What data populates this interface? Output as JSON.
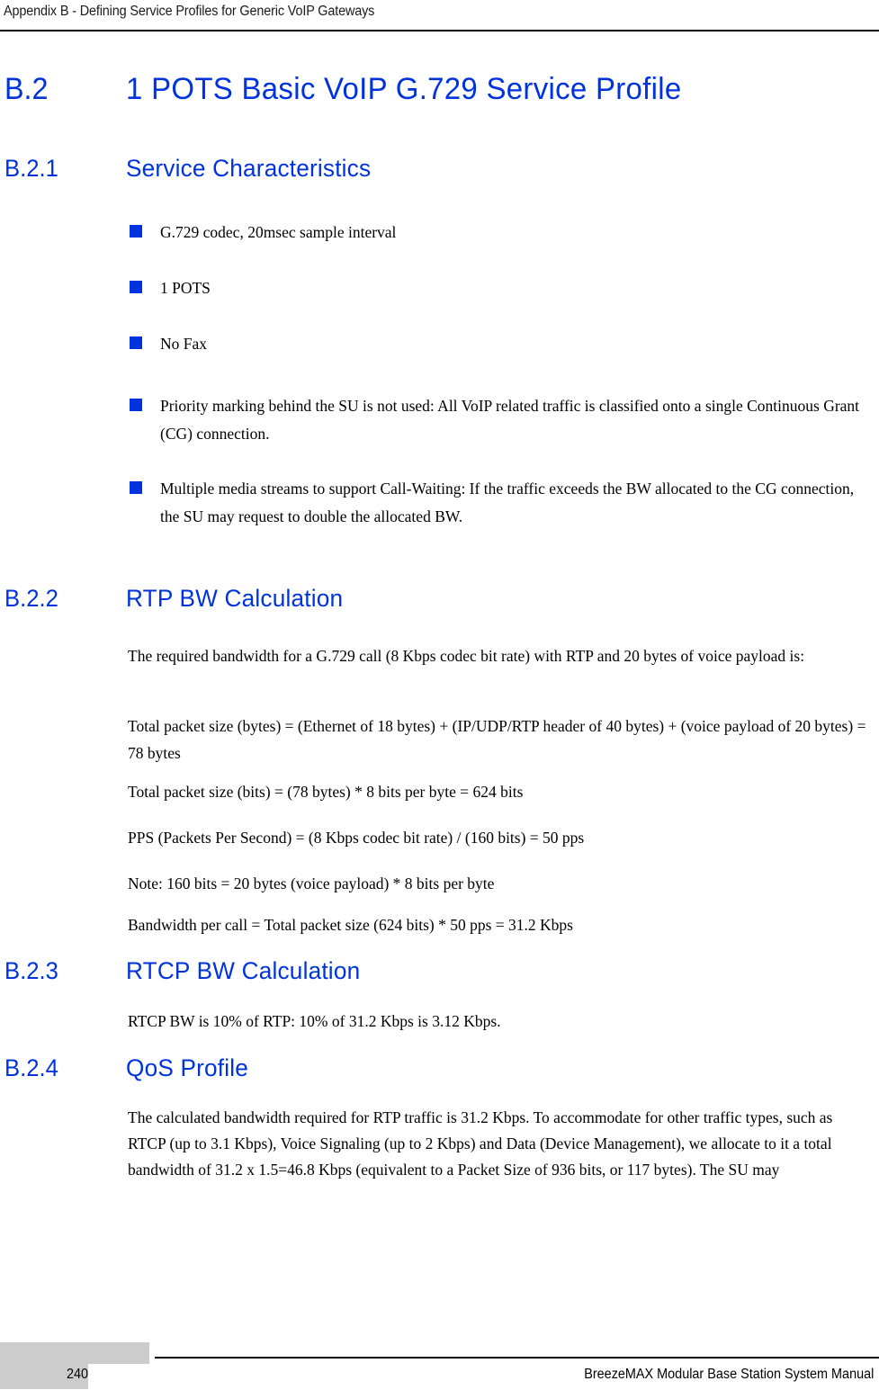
{
  "header": {
    "running_head": "Appendix B - Defining Service Profiles for Generic VoIP Gateways"
  },
  "colors": {
    "heading_blue": "#0033dd",
    "bullet_blue": "#0033dd",
    "footer_gray": "#cccccc",
    "body_black": "#000000"
  },
  "title": {
    "number": "B.2",
    "text": "1 POTS Basic VoIP G.729 Service Profile"
  },
  "sections": [
    {
      "number": "B.2.1",
      "title": "Service Characteristics",
      "bullets": [
        "G.729 codec, 20msec sample interval",
        "1 POTS",
        "No Fax",
        "Priority marking behind the SU is not used: All VoIP related traffic is classified onto a single Continuous Grant (CG) connection.",
        "Multiple media streams to support Call-Waiting: If the traffic exceeds the BW allocated to the CG connection, the SU may request to double the allocated BW."
      ]
    },
    {
      "number": "B.2.2",
      "title": "RTP BW Calculation",
      "paragraphs": [
        "The required bandwidth for a G.729 call (8 Kbps codec bit rate) with RTP and 20 bytes of voice payload is:",
        "Total packet size (bytes) = (Ethernet of 18 bytes) + (IP/UDP/RTP header of 40 bytes) + (voice payload of 20 bytes) = 78 bytes",
        "Total packet size (bits) = (78 bytes) * 8 bits per byte = 624 bits",
        "PPS (Packets Per Second) = (8 Kbps codec bit rate) / (160 bits) = 50 pps",
        "Note: 160 bits = 20 bytes (voice payload) * 8 bits per byte",
        "Bandwidth per call = Total packet size (624 bits) * 50 pps = 31.2 Kbps"
      ]
    },
    {
      "number": "B.2.3",
      "title": "RTCP BW Calculation",
      "paragraphs": [
        "RTCP BW is 10% of RTP: 10% of 31.2 Kbps is 3.12 Kbps."
      ]
    },
    {
      "number": "B.2.4",
      "title": "QoS Profile",
      "paragraphs": [
        "The calculated bandwidth required for RTP traffic is 31.2 Kbps. To accommodate for other traffic types, such as RTCP (up to 3.1 Kbps), Voice Signaling (up to 2 Kbps) and Data (Device Management), we allocate to it a total bandwidth of 31.2 x 1.5=46.8 Kbps (equivalent to a Packet Size of 936 bits, or 117 bytes). The SU may"
      ]
    }
  ],
  "footer": {
    "page_number": "240",
    "manual_title": "BreezeMAX Modular Base Station System Manual"
  }
}
